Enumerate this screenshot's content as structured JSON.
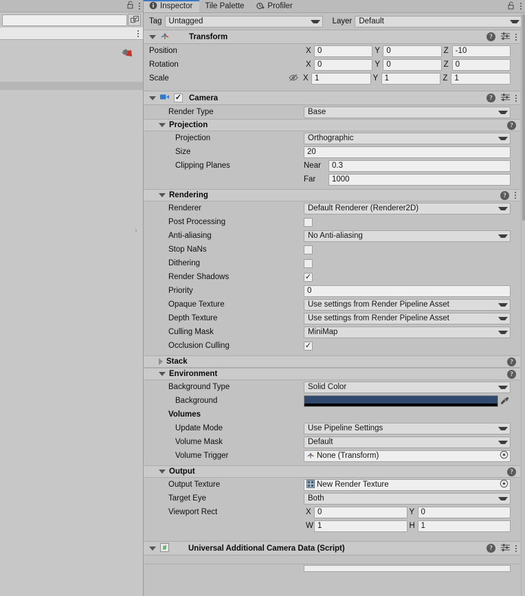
{
  "left_panel": {
    "lock_icon": "lock-open-icon",
    "menu_icon": "kebab-menu-icon",
    "search_value": "",
    "search_placeholder": "",
    "open_external_icon": "open-external-icon",
    "row_menu_icon": "kebab-menu-icon",
    "badge_icon": "error-badge-icon",
    "chevron_icon": "chevron-right-icon"
  },
  "tabbar": {
    "tabs": [
      {
        "label": "Inspector",
        "icon": "inspector-info-icon",
        "active": true
      },
      {
        "label": "Tile Palette",
        "icon": "tile-palette-icon",
        "active": false
      },
      {
        "label": "Profiler",
        "icon": "profiler-icon",
        "active": false
      }
    ],
    "lock_icon": "lock-open-icon",
    "menu_icon": "kebab-menu-icon"
  },
  "tag_layer": {
    "tag_label": "Tag",
    "tag_value": "Untagged",
    "layer_label": "Layer",
    "layer_value": "Default"
  },
  "components": [
    {
      "name": "Transform",
      "icon": "transform-axis-icon",
      "expanded": true,
      "has_checkbox": false,
      "help_icon": "help-icon",
      "preset_icon": "preset-settings-icon",
      "menu_icon": "kebab-menu-icon",
      "rows": [
        {
          "type": "vector3",
          "label": "Position",
          "axes": [
            "X",
            "Y",
            "Z"
          ],
          "values": [
            "0",
            "0",
            "-10"
          ]
        },
        {
          "type": "vector3",
          "label": "Rotation",
          "axes": [
            "X",
            "Y",
            "Z"
          ],
          "values": [
            "0",
            "0",
            "0"
          ]
        },
        {
          "type": "vector3",
          "label": "Scale",
          "axes": [
            "X",
            "Y",
            "Z"
          ],
          "values": [
            "1",
            "1",
            "1"
          ],
          "prefix_icon": "constrain-proportions-off-icon"
        }
      ]
    }
  ],
  "camera": {
    "title": "Camera",
    "icon": "camera-icon",
    "enabled": true,
    "checkbox_glyph": "✓",
    "help_icon": "help-icon",
    "preset_icon": "preset-settings-icon",
    "menu_icon": "kebab-menu-icon",
    "render_type": {
      "label": "Render Type",
      "value": "Base"
    },
    "sections": {
      "projection": {
        "title": "Projection",
        "expanded": true,
        "help_icon": "help-icon",
        "projection": {
          "label": "Projection",
          "value": "Orthographic"
        },
        "size": {
          "label": "Size",
          "value": "20"
        },
        "clipping_planes": {
          "label": "Clipping Planes",
          "near_label": "Near",
          "near_value": "0.3",
          "far_label": "Far",
          "far_value": "1000"
        }
      },
      "rendering": {
        "title": "Rendering",
        "expanded": true,
        "help_icon": "help-icon",
        "menu_icon": "kebab-menu-icon",
        "rows": [
          {
            "type": "dropdown",
            "label": "Renderer",
            "value": "Default Renderer (Renderer2D)"
          },
          {
            "type": "checkbox",
            "label": "Post Processing",
            "checked": false
          },
          {
            "type": "dropdown",
            "label": "Anti-aliasing",
            "value": "No Anti-aliasing"
          },
          {
            "type": "checkbox",
            "label": "Stop NaNs",
            "checked": false
          },
          {
            "type": "checkbox",
            "label": "Dithering",
            "checked": false
          },
          {
            "type": "checkbox",
            "label": "Render Shadows",
            "checked": true
          },
          {
            "type": "text",
            "label": "Priority",
            "value": "0"
          },
          {
            "type": "dropdown",
            "label": "Opaque Texture",
            "value": "Use settings from Render Pipeline Asset"
          },
          {
            "type": "dropdown",
            "label": "Depth Texture",
            "value": "Use settings from Render Pipeline Asset"
          },
          {
            "type": "dropdown",
            "label": "Culling Mask",
            "value": "MiniMap"
          },
          {
            "type": "checkbox",
            "label": "Occlusion Culling",
            "checked": true
          }
        ]
      },
      "stack": {
        "title": "Stack",
        "expanded": false,
        "help_icon": "help-icon"
      },
      "environment": {
        "title": "Environment",
        "expanded": true,
        "help_icon": "help-icon",
        "background_type": {
          "label": "Background Type",
          "value": "Solid Color"
        },
        "background": {
          "label": "Background",
          "color": "#32496f",
          "alpha_color": "#000000",
          "eyedropper_icon": "eyedropper-icon"
        },
        "volumes_label": "Volumes",
        "update_mode": {
          "label": "Update Mode",
          "value": "Use Pipeline Settings"
        },
        "volume_mask": {
          "label": "Volume Mask",
          "value": "Default"
        },
        "volume_trigger": {
          "label": "Volume Trigger",
          "value": "None (Transform)",
          "icon": "transform-axis-icon",
          "picker_icon": "object-picker-icon"
        }
      },
      "output": {
        "title": "Output",
        "expanded": true,
        "help_icon": "help-icon",
        "output_texture": {
          "label": "Output Texture",
          "value": "New Render Texture",
          "icon": "render-texture-icon",
          "picker_icon": "object-picker-icon"
        },
        "target_eye": {
          "label": "Target Eye",
          "value": "Both"
        },
        "viewport_rect": {
          "label": "Viewport Rect",
          "x_label": "X",
          "x_value": "0",
          "y_label": "Y",
          "y_value": "0",
          "w_label": "W",
          "w_value": "1",
          "h_label": "H",
          "h_value": "1"
        }
      }
    }
  },
  "script_component": {
    "title": "Universal Additional Camera Data (Script)",
    "icon": "cs-script-icon",
    "expanded": true,
    "help_icon": "help-icon",
    "preset_icon": "preset-settings-icon",
    "menu_icon": "kebab-menu-icon"
  },
  "colors": {
    "panel_bg": "#c2c2c2",
    "header_bg": "#c9c9c9",
    "field_bg": "#efefef",
    "dropdown_bg": "#dcdcdc",
    "accent_tab": "#3c79c6",
    "camera_icon": "#2a7ad4"
  }
}
